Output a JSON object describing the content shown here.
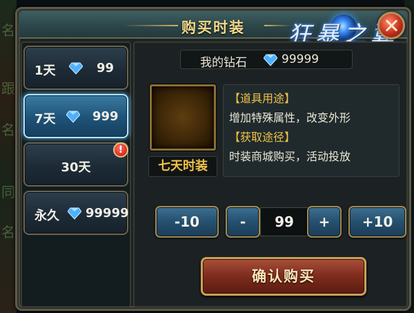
{
  "window": {
    "title": "购买时装",
    "logo_text": "狂暴之翼"
  },
  "background": {
    "ghost_text": [
      "名",
      "跟",
      "名",
      "同",
      "名"
    ]
  },
  "options": [
    {
      "label": "1天",
      "price": "99",
      "selected": false,
      "alert": false
    },
    {
      "label": "7天",
      "price": "999",
      "selected": true,
      "alert": false
    },
    {
      "label": "30天",
      "price": "",
      "selected": false,
      "alert": true
    },
    {
      "label": "永久",
      "price": "99999",
      "selected": false,
      "alert": false
    }
  ],
  "alert_symbol": "!",
  "wallet": {
    "label": "我的钻石",
    "value": "99999"
  },
  "item": {
    "name": "七天时装"
  },
  "description": {
    "usage_heading": "【道具用途】",
    "usage_text": "增加特殊属性，改变外形",
    "source_heading": "【获取途径】",
    "source_text": "时装商城购买，活动投放"
  },
  "quantity": {
    "minus10": "-10",
    "minus": "-",
    "value": "99",
    "plus": "+",
    "plus10": "+10"
  },
  "confirm_label": "确认购买",
  "colors": {
    "gold_text": "#f1c24a",
    "selected_glow": "#5cc0ff",
    "confirm_red": "#7e2b1c"
  },
  "icons": {
    "currency": "diamond-icon",
    "alert": "exclamation-icon",
    "close": "close-icon"
  }
}
